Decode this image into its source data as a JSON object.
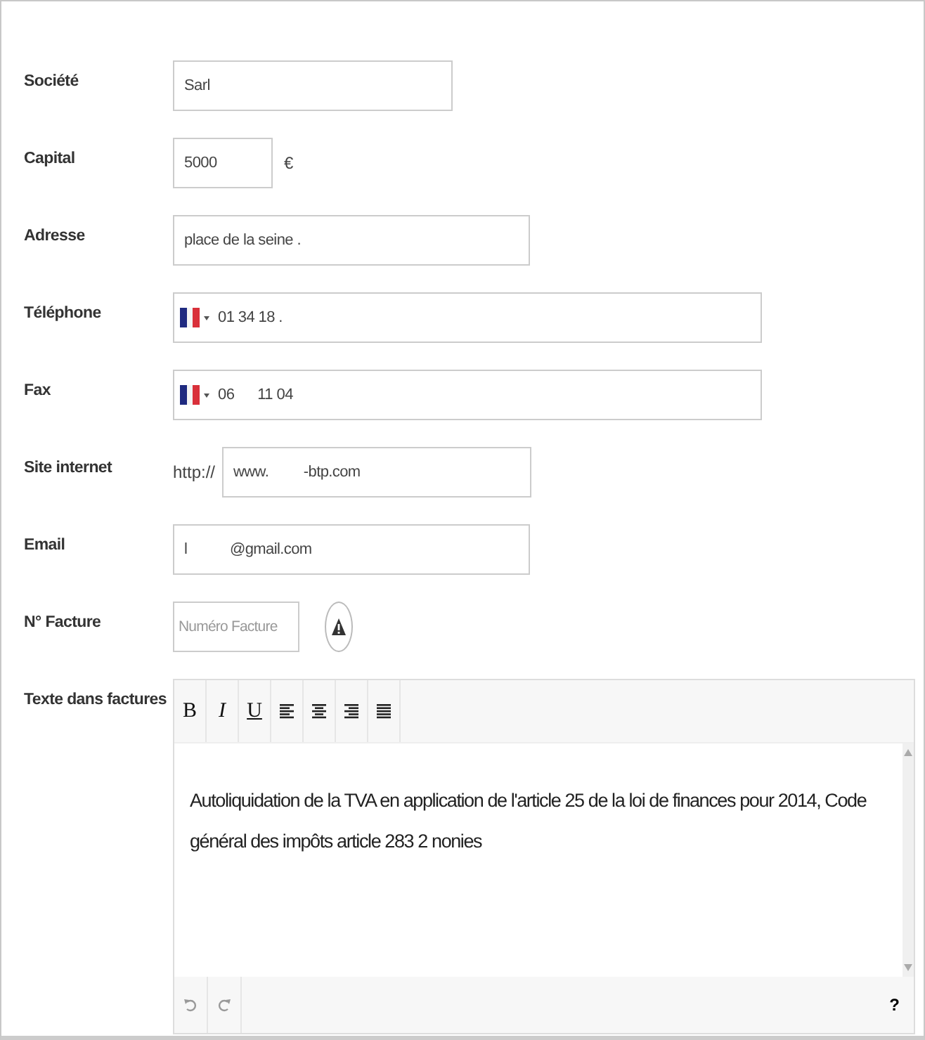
{
  "fields": [
    {
      "label": "Société",
      "kind": "text",
      "value": "Sarl"
    },
    {
      "label": "Capital",
      "kind": "text",
      "value": "5000",
      "suffix": "€"
    },
    {
      "label": "Adresse",
      "kind": "text",
      "value": "place de la seine ."
    },
    {
      "label": "Téléphone",
      "kind": "phone",
      "value": "01 34 18 ."
    },
    {
      "label": "Fax",
      "kind": "phone",
      "value": "06      11 04"
    },
    {
      "label": "Site internet",
      "kind": "url",
      "prefix": "http://",
      "value": "www.         -btp.com"
    },
    {
      "label": "Email",
      "kind": "text",
      "value": "l           @gmail.com"
    },
    {
      "label": "N° Facture",
      "kind": "invoice",
      "placeholder": "Numéro Facture"
    }
  ],
  "editor": {
    "label": "Texte dans factures",
    "toolbar": [
      {
        "kind": "bold",
        "label": "B"
      },
      {
        "kind": "italic",
        "label": "I"
      },
      {
        "kind": "underline",
        "label": "U"
      },
      {
        "kind": "align-left"
      },
      {
        "kind": "align-center"
      },
      {
        "kind": "align-right"
      },
      {
        "kind": "justify"
      }
    ],
    "content": "Autoliquidation de la TVA en application de l'article 25 de la loi de finances pour 2014, Code général des impôts article 283 2 nonies",
    "help": "?"
  }
}
